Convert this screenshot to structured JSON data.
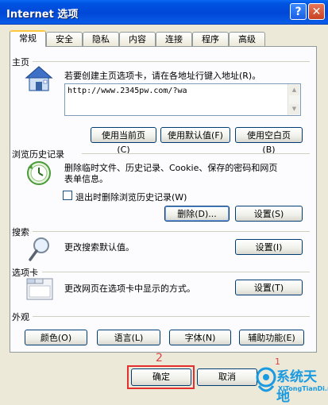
{
  "window": {
    "title": "Internet 选项",
    "help_label": "?",
    "close_label": "✕"
  },
  "tabs": [
    {
      "label": "常规",
      "active": true
    },
    {
      "label": "安全"
    },
    {
      "label": "隐私"
    },
    {
      "label": "内容"
    },
    {
      "label": "连接"
    },
    {
      "label": "程序"
    },
    {
      "label": "高级"
    }
  ],
  "homepage": {
    "section_label": "主页",
    "description": "若要创建主页选项卡，请在各地址行键入地址(R)。",
    "url_value": "http://www.2345pw.com/?wa",
    "buttons": [
      "使用当前页(C)",
      "使用默认值(F)",
      "使用空白页(B)"
    ]
  },
  "history": {
    "section_label": "浏览历史记录",
    "description_line1": "删除临时文件、历史记录、Cookie、保存的密码和网页",
    "description_line2": "表单信息。",
    "checkbox_label": "退出时删除浏览历史记录(W)",
    "checkbox_checked": false,
    "delete_button": "删除(D)...",
    "settings_button": "设置(S)"
  },
  "search": {
    "section_label": "搜索",
    "description": "更改搜索默认值。",
    "settings_button": "设置(I)"
  },
  "tabs_section": {
    "section_label": "选项卡",
    "description": "更改网页在选项卡中显示的方式。",
    "settings_button": "设置(T)"
  },
  "appearance": {
    "section_label": "外观",
    "buttons": [
      "颜色(O)",
      "语言(L)",
      "字体(N)",
      "辅助功能(E)"
    ]
  },
  "footer": {
    "ok_button": "确定",
    "cancel_button": "取消",
    "step_number_ok": "2",
    "step_number_cancel": "1"
  },
  "watermark": {
    "title": "系统天地",
    "subtitle": "XiTongTianDi.net"
  },
  "colors": {
    "titlebar": "#0053e2",
    "dialog_bg": "#ece9d8",
    "highlight_box": "#e52f2f"
  }
}
